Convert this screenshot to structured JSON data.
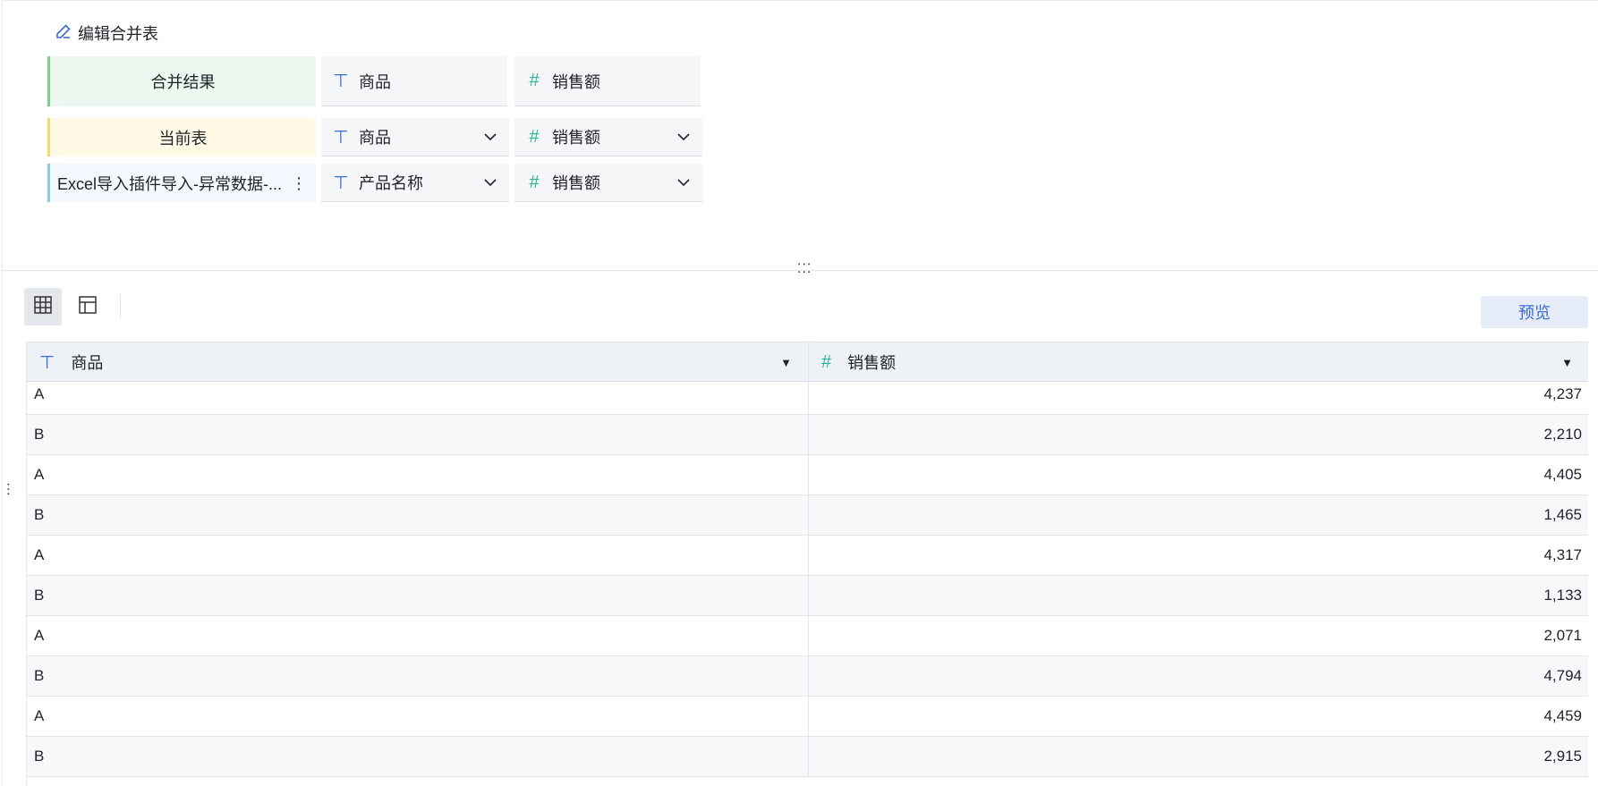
{
  "editor": {
    "title": "编辑合并表",
    "rows": [
      {
        "label": "合并结果",
        "fields": [
          {
            "type": "text",
            "name": "商品"
          },
          {
            "type": "number",
            "name": "销售额"
          }
        ]
      },
      {
        "label": "当前表",
        "fields": [
          {
            "type": "text",
            "name": "商品"
          },
          {
            "type": "number",
            "name": "销售额"
          }
        ]
      },
      {
        "label": "Excel导入插件导入-异常数据-...",
        "fields": [
          {
            "type": "text",
            "name": "产品名称"
          },
          {
            "type": "number",
            "name": "销售额"
          }
        ]
      }
    ],
    "colors": {
      "result_accent": "#7ccf8e",
      "current_accent": "#f9d770",
      "source_accent": "#8bc8f2"
    }
  },
  "toolbar": {
    "preview_label": "预览"
  },
  "icons": {
    "text_field": "T",
    "number_field": "#"
  },
  "table": {
    "columns": [
      {
        "type": "text",
        "name": "商品"
      },
      {
        "type": "number",
        "name": "销售额"
      }
    ],
    "rows": [
      [
        "A",
        "4,237"
      ],
      [
        "B",
        "2,210"
      ],
      [
        "A",
        "4,405"
      ],
      [
        "B",
        "1,465"
      ],
      [
        "A",
        "4,317"
      ],
      [
        "B",
        "1,133"
      ],
      [
        "A",
        "2,071"
      ],
      [
        "B",
        "4,794"
      ],
      [
        "A",
        "4,459"
      ],
      [
        "B",
        "2,915"
      ]
    ]
  }
}
